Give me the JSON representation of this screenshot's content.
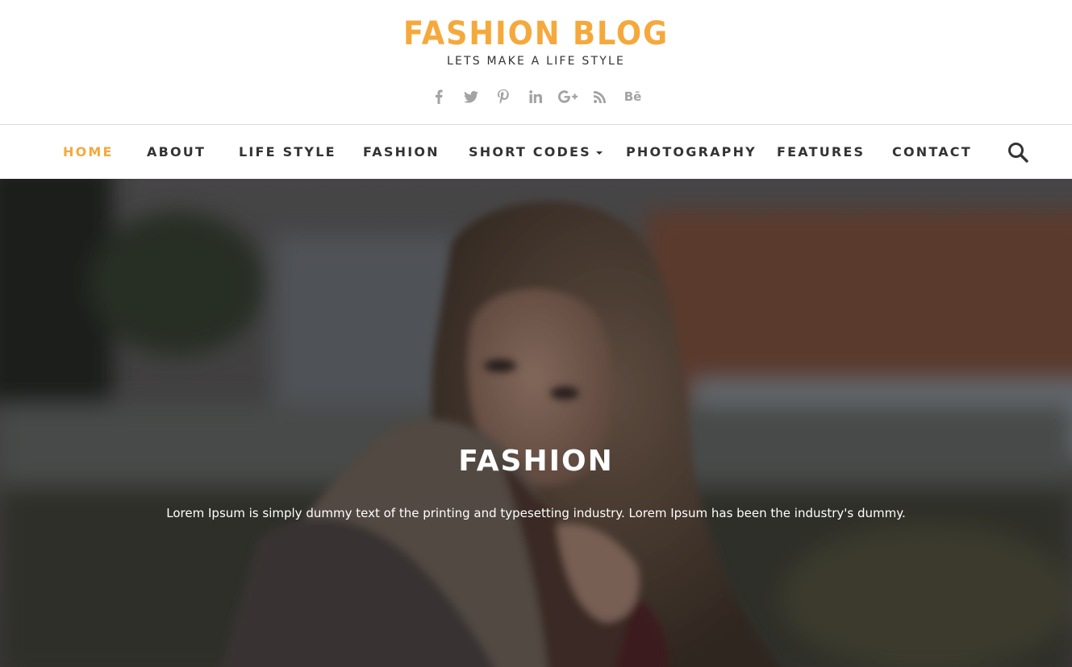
{
  "colors": {
    "accent": "#f5a93c",
    "nav_text": "#333333",
    "social_icon": "#a3a3a3"
  },
  "header": {
    "title": "FASHION BLOG",
    "tagline": "LETS MAKE A LIFE STYLE",
    "social": [
      "facebook-icon",
      "twitter-icon",
      "pinterest-icon",
      "linkedin-icon",
      "google-plus-icon",
      "rss-icon",
      "behance-icon"
    ],
    "behance_glyph": "Bē"
  },
  "nav": {
    "items": [
      {
        "label": "HOME",
        "active": true
      },
      {
        "label": "ABOUT",
        "active": false
      },
      {
        "label": "LIFE STYLE",
        "active": false
      },
      {
        "label": "FASHION",
        "active": false
      },
      {
        "label": "SHORT CODES",
        "active": false,
        "dropdown": true
      },
      {
        "label": "PHOTOGRAPHY",
        "active": false
      },
      {
        "label": "FEATURES",
        "active": false
      },
      {
        "label": "CONTACT",
        "active": false
      }
    ],
    "search_icon": "search-icon"
  },
  "hero": {
    "title": "FASHION",
    "text": "Lorem Ipsum is simply dummy text of the printing and typesetting industry. Lorem Ipsum has been the industry's dummy."
  }
}
